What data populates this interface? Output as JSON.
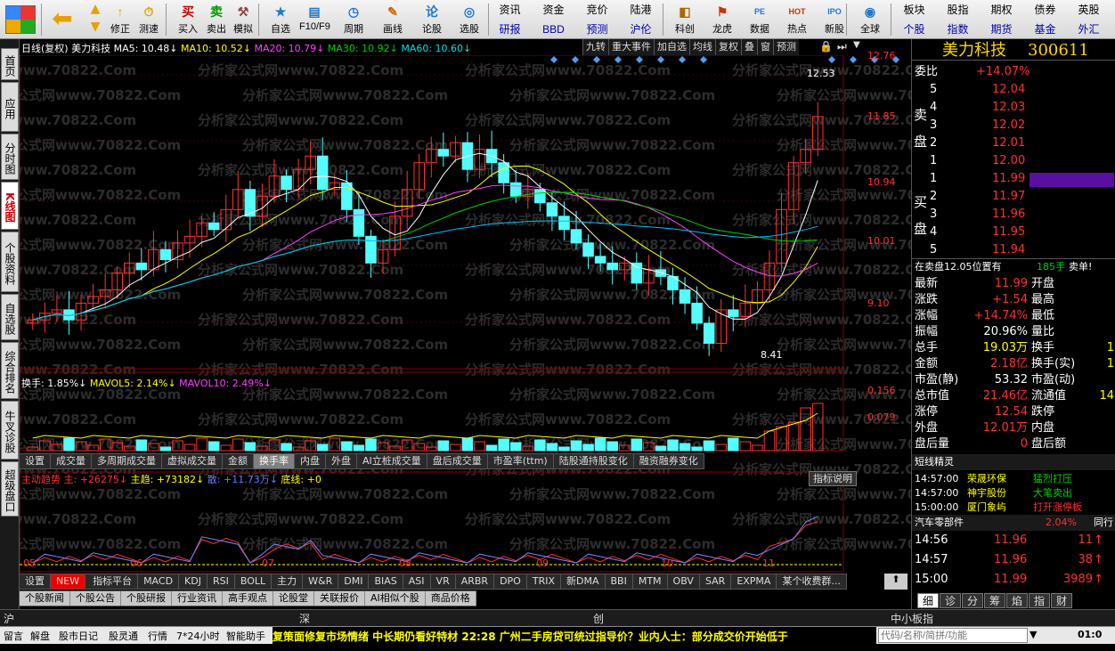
{
  "toolbar": {
    "buttons": [
      {
        "label": "修正",
        "icon": "↑"
      },
      {
        "label": "测速",
        "icon": "⏱"
      },
      {
        "label": "买入",
        "icon": "买"
      },
      {
        "label": "卖出",
        "icon": "卖"
      },
      {
        "label": "模拟",
        "icon": "⚒"
      },
      {
        "label": "自选",
        "icon": "★"
      },
      {
        "label": "F10/F9",
        "icon": "▤"
      },
      {
        "label": "周期",
        "icon": "◷"
      },
      {
        "label": "画线",
        "icon": "✎"
      },
      {
        "label": "论股",
        "icon": "论"
      },
      {
        "label": "选股",
        "icon": "◎"
      },
      {
        "label": "科创",
        "icon": "◧"
      },
      {
        "label": "龙虎",
        "icon": "⚑"
      },
      {
        "label": "数据",
        "icon": "PE"
      },
      {
        "label": "热点",
        "icon": "HOT"
      },
      {
        "label": "新股",
        "icon": "IPO"
      },
      {
        "label": "全球",
        "icon": "◉"
      }
    ],
    "grid1": [
      "资讯",
      "资金",
      "竞价",
      "陆港",
      "研报",
      "BBD",
      "预测",
      "沪伦"
    ],
    "grid2": [
      "板块",
      "股指",
      "期权",
      "债券",
      "英股",
      "个股",
      "指数",
      "期货",
      "基金",
      "外汇"
    ]
  },
  "lefttabs": [
    "首页",
    "应用",
    "分时图",
    "K线图",
    "个股资料",
    "自选股",
    "综合排名",
    "牛叉诊股",
    "超级盘口"
  ],
  "chart_header": {
    "period": "日线(复权)",
    "name": "美力科技",
    "ma5": "MA5: 10.48↓",
    "ma10": "MA10: 10.52↓",
    "ma20": "MA20: 10.79↓",
    "ma30": "MA30: 10.92↓",
    "ma60": "MA60: 10.60↓",
    "menu": [
      "九转",
      "重大事件",
      "加自选",
      "均线",
      "复权",
      "叠",
      "窗",
      "预测"
    ]
  },
  "price_axis": [
    "12.76",
    "11.85",
    "10.94",
    "10.01",
    "9.10"
  ],
  "price_marks": {
    "high": "12.53",
    "low": "8.41"
  },
  "vol_header": {
    "label": "换手: 1.85%↓",
    "mavol5": "MAVOL5: 2.14%↓",
    "mavol10": "MAVOL10: 2.49%↓"
  },
  "vol_axis": [
    "0.156",
    "0.079"
  ],
  "tabs1": [
    "设置",
    "成交量",
    "多周期成交量",
    "虚拟成交量",
    "金额",
    "换手率",
    "内盘",
    "外盘",
    "AI立桩成交量",
    "盘后成交量",
    "市盈率(ttm)",
    "陆股通持股变化",
    "融资融券变化"
  ],
  "ind_header": {
    "main": "主动趋势 主: +26275↓",
    "zhuqu": "主趋: +73182↓",
    "san": "散: +11.73万↓",
    "dixian": "底线: +0",
    "explain": "指标说明"
  },
  "xaxis": [
    "05",
    "06",
    "07",
    "08",
    "09",
    "10",
    "11"
  ],
  "tabs2": [
    "设置",
    "指标平台",
    "MACD",
    "KDJ",
    "RSI",
    "BOLL",
    "主力",
    "W&R",
    "DMI",
    "BIAS",
    "ASI",
    "VR",
    "ARBR",
    "DPO",
    "TRIX",
    "新DMA",
    "BBI",
    "MTM",
    "OBV",
    "SAR",
    "EXPMA",
    "某个收费群..."
  ],
  "tabs3": [
    "个股新闻",
    "个股公告",
    "个股研报",
    "行业资讯",
    "高手观点",
    "论股堂",
    "关联报价",
    "AI相似个股",
    "商品价格"
  ],
  "watermark": "分析家公式网www.70822.Com",
  "stock": {
    "name": "美力科技",
    "code": "300611"
  },
  "weibi": {
    "label": "委比",
    "value": "+14.07%"
  },
  "sell": [
    {
      "n": "5",
      "p": "12.04"
    },
    {
      "n": "4",
      "p": "12.03"
    },
    {
      "n": "3",
      "p": "12.02"
    },
    {
      "n": "2",
      "p": "12.01"
    },
    {
      "n": "1",
      "p": "12.00"
    }
  ],
  "buy": [
    {
      "n": "1",
      "p": "11.99"
    },
    {
      "n": "2",
      "p": "11.97"
    },
    {
      "n": "3",
      "p": "11.96"
    },
    {
      "n": "4",
      "p": "11.95"
    },
    {
      "n": "5",
      "p": "11.94"
    }
  ],
  "sell_label": "卖盘",
  "buy_label": "买盘",
  "order_info": {
    "text": "在卖盘12.05位置有",
    "qty": "185手",
    "tag": "卖单!"
  },
  "quote": [
    {
      "l": "最新",
      "v": "11.99",
      "l2": "开盘"
    },
    {
      "l": "涨跌",
      "v": "+1.54",
      "l2": "最高"
    },
    {
      "l": "涨幅",
      "v": "+14.74%",
      "l2": "最低"
    },
    {
      "l": "振幅",
      "v": "20.96%",
      "l2": "量比"
    },
    {
      "l": "总手",
      "v": "19.03万",
      "l2": "换手",
      "v2": "1"
    },
    {
      "l": "金额",
      "v": "2.18亿",
      "l2": "换手(实)",
      "v2": "1"
    },
    {
      "l": "市盈(静)",
      "v": "53.32",
      "l2": "市盈(动)"
    },
    {
      "l": "总市值",
      "v": "21.46亿",
      "l2": "流通值",
      "v2": "14"
    },
    {
      "l": "涨停",
      "v": "12.54",
      "l2": "跌停"
    },
    {
      "l": "外盘",
      "v": "12.01万",
      "l2": "内盘"
    },
    {
      "l": "盘后量",
      "v": "0",
      "l2": "盘后额"
    }
  ],
  "short_title": "短线精灵",
  "short": [
    {
      "t": "14:57:00",
      "n": "荣晟环保",
      "e": "猛烈打压"
    },
    {
      "t": "14:57:00",
      "n": "神宇股份",
      "e": "大笔卖出"
    },
    {
      "t": "15:00:00",
      "n": "厦门象屿",
      "e": "打开涨停板"
    }
  ],
  "sector": {
    "name": "汽车零部件",
    "pct": "2.04%",
    "tag": "同行"
  },
  "ticks": [
    {
      "t": "14:56",
      "p": "11.96",
      "v": "11"
    },
    {
      "t": "14:57",
      "p": "11.96",
      "v": "38"
    },
    {
      "t": "15:00",
      "p": "11.99",
      "v": "3989"
    }
  ],
  "rtabs": [
    "细",
    "诊",
    "分",
    "筹",
    "焰",
    "指",
    "财"
  ],
  "bottom1": [
    "沪",
    "深",
    "创",
    "中小板指"
  ],
  "status": [
    "留言",
    "解盘",
    "股市日记",
    "股灵通",
    "行情",
    "7*24小时",
    "智能助手"
  ],
  "ticker": "复策面修复市场情绪 中长期仍看好特材    22:28 广州二手房贷可统过指导价？业内人士：部分成交价开始低于",
  "search_placeholder": "代码/名称/简拼/功能",
  "clock": "01:0",
  "chart_data": {
    "type": "candlestick",
    "x": [
      "05",
      "06",
      "07",
      "08",
      "09",
      "10",
      "11"
    ],
    "ylim": [
      8.41,
      12.76
    ],
    "series": [
      {
        "name": "MA5",
        "value": 10.48
      },
      {
        "name": "MA10",
        "value": 10.52
      },
      {
        "name": "MA20",
        "value": 10.79
      },
      {
        "name": "MA30",
        "value": 10.92
      },
      {
        "name": "MA60",
        "value": 10.6
      }
    ],
    "close": [
      8.95,
      9.05,
      9.1,
      8.95,
      9.2,
      9.3,
      9.4,
      9.65,
      9.8,
      9.7,
      10.0,
      9.85,
      10.1,
      10.2,
      10.4,
      10.3,
      10.6,
      10.9,
      10.5,
      10.8,
      11.1,
      10.9,
      11.2,
      11.4,
      10.9,
      11.0,
      10.6,
      10.2,
      9.8,
      10.0,
      10.5,
      10.9,
      11.3,
      11.5,
      11.4,
      11.6,
      11.2,
      11.5,
      11.3,
      11.0,
      10.8,
      10.9,
      10.7,
      10.5,
      10.3,
      10.1,
      9.9,
      9.8,
      9.7,
      9.8,
      9.5,
      9.7,
      9.6,
      9.4,
      9.2,
      8.9,
      8.6,
      9.1,
      9.0,
      9.2,
      9.4,
      9.8,
      10.6,
      11.3,
      11.5,
      11.99
    ]
  }
}
